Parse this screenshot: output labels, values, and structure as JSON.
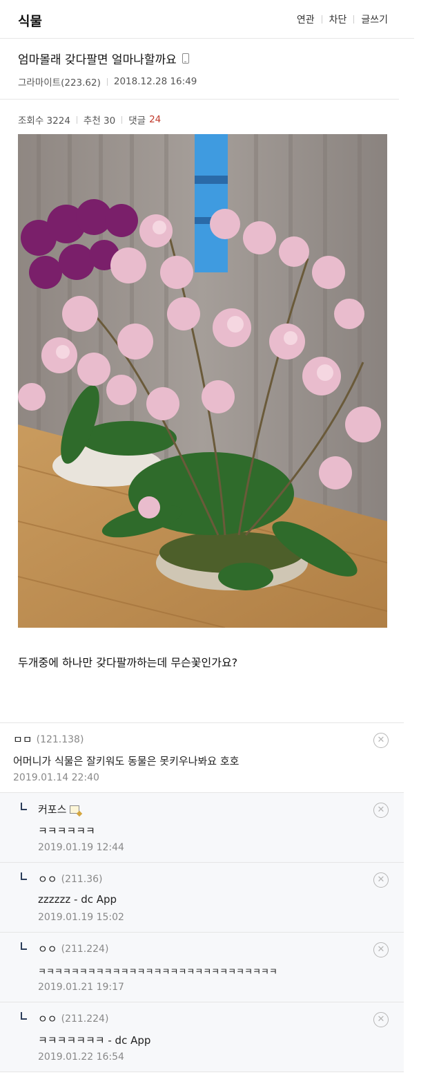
{
  "header": {
    "board_title": "식물",
    "actions": [
      "연관",
      "차단",
      "글쓰기"
    ]
  },
  "post": {
    "title": "엄마몰래 갖다팔면 얼마나할까요",
    "author": "그라마이트(223.62)",
    "date": "2018.12.28 16:49",
    "views_label": "조회수 3224",
    "recommend_label": "추천 30",
    "comments_label": "댓글",
    "comments_count": "24",
    "body": "두개중에 하나만 갖다팔까하는데 무슨꽃인가요?"
  },
  "comments": [
    {
      "author": "ㅁㅁ",
      "ip": "(121.138)",
      "text": "어머니가 식물은 잘키워도 동물은 못키우나봐요 호호",
      "date": "2019.01.14 22:40"
    },
    {
      "author": "커포스",
      "ip": "",
      "text": "ㅋㅋㅋㅋㅋㅋ",
      "date": "2019.01.19 12:44"
    },
    {
      "author": "ㅇㅇ",
      "ip": "(211.36)",
      "text": "zzzzzz - dc App",
      "date": "2019.01.19 15:02"
    },
    {
      "author": "ㅇㅇ",
      "ip": "(211.224)",
      "text": "ㅋㅋㅋㅋㅋㅋㅋㅋㅋㅋㅋㅋㅋㅋㅋㅋㅋㅋㅋㅋㅋㅋㅋㅋㅋㅋㅋㅋㅋ",
      "date": "2019.01.21 19:17"
    },
    {
      "author": "ㅇㅇ",
      "ip": "(211.224)",
      "text": "ㅋㅋㅋㅋㅋㅋㅋ - dc App",
      "date": "2019.01.22 16:54"
    }
  ],
  "icons": {
    "device": "phone-icon",
    "delete": "close-icon",
    "reply": "reply-arrow-icon",
    "memo": "memo-icon"
  },
  "colors": {
    "comment_count": "#c0392b",
    "reply_bg": "#f7f8fa",
    "reply_mark": "#2b3d5a"
  }
}
